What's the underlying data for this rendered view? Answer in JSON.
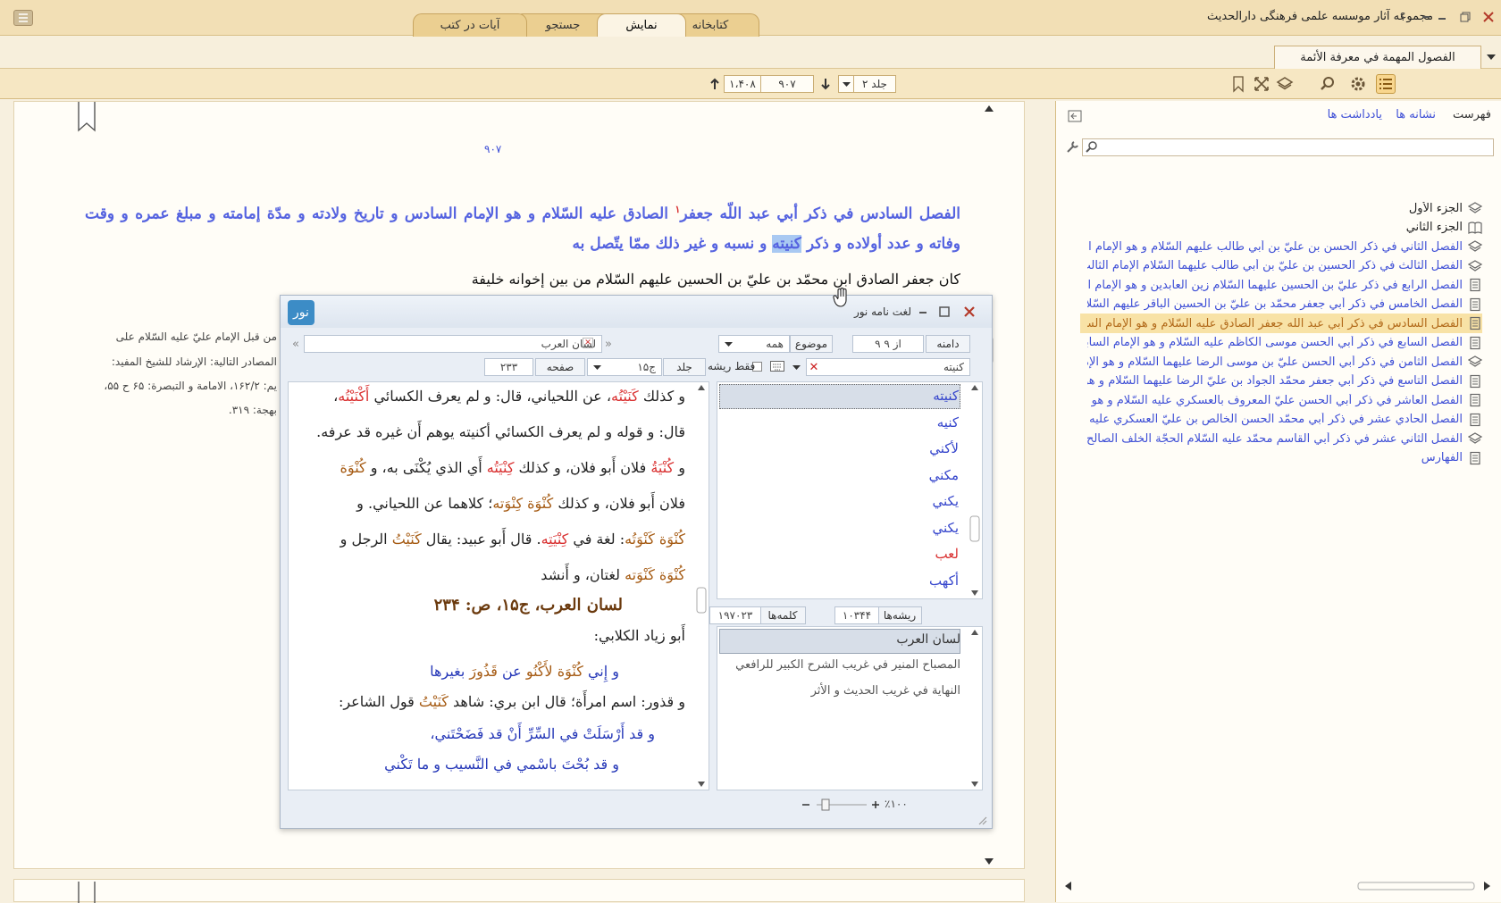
{
  "app": {
    "title": "مجموعه آثار موسسه علمی فرهنگی دارالحدیث",
    "help": "؟",
    "tabs": [
      "کتابخانه",
      "نمایش",
      "جستجو",
      "آیات در کتب"
    ],
    "active_tab": "نمایش"
  },
  "document_tab": "الفصول المهمة في معرفة الأئمة",
  "toolbar": {
    "volume": "جلد ۲",
    "page": "۹۰۷",
    "total_pages": "۱،۴۰۸"
  },
  "page": {
    "page_number": "۹۰۷",
    "chapter_title_part1": "الفصل السادس في ذكر أبي عبد اللّه جعفر",
    "footnote_marker": "١",
    "chapter_title_part2": "الصادق عليه السّلام و هو الإمام السادس و تاريخ ولادته و مدّة إمامته و مبلغ عمره و وقت وفاته و عدد أولاده و ذكر",
    "highlighted_word": "كنيته",
    "chapter_title_part3": "و نسبه و غير ذلك ممّا يتّصل به",
    "first_line": "كان جعفر الصادق ابن محمّد بن عليّ بن الحسين عليهم السّلام من بين إخوانه خليفة",
    "footnotes": [
      "من قبل الإمام عليّ عليه السّلام على",
      "المصادر التالية: الإرشاد للشيخ المفيد:",
      "يم: ۱۶۲/۲، الامامة و التبصرة: ۶۵ ح ۵۵،",
      "بهجة: ۳۱۹."
    ]
  },
  "sidebar": {
    "tabs": [
      "فهرست",
      "نشانه ها",
      "یادداشت ها"
    ],
    "search_placeholder": "",
    "tree": [
      {
        "label": "الجزء الأول",
        "type": "part"
      },
      {
        "label": "الجزء الثاني",
        "type": "part-open"
      },
      {
        "label": "الفصل الثاني في ذكر الحسن بن عليّ بن أبي طالب عليهم السّلام و هو الإمام الثاني",
        "type": "item"
      },
      {
        "label": "الفصل الثالث في ذكر الحسين بن عليّ بن أبي طالب عليهما السّلام الإمام الثالث",
        "type": "item"
      },
      {
        "label": "الفصل الرابع في ذكر عليّ بن الحسين عليهما السّلام زين العابدين و هو الإمام الرابع",
        "type": "item"
      },
      {
        "label": "الفصل الخامس في ذكر أبي جعفر محمّد بن عليّ بن الحسين الباقر عليهم السّلام",
        "type": "item"
      },
      {
        "label": "الفصل السادس في ذكر أبي عبد اللّه جعفر الصادق عليه السّلام و هو الإمام السادس",
        "type": "selected"
      },
      {
        "label": "الفصل السابع في ذكر أبي الحسن موسى الكاظم عليه السّلام و هو الإمام السابع",
        "type": "item"
      },
      {
        "label": "الفصل الثامن في ذكر أبي الحسن عليّ بن موسى الرضا عليهما السّلام و هو الإمام الثامن",
        "type": "item"
      },
      {
        "label": "الفصل التاسع في ذكر أبي جعفر محمّد الجواد بن عليّ الرضا عليهما السّلام و هو",
        "type": "item"
      },
      {
        "label": "الفصل العاشر في ذكر أبي الحسن عليّ المعروف بالعسكري عليه السّلام و هو الإمام",
        "type": "item"
      },
      {
        "label": "الفصل الحادي عشر في ذكر أبي محمّد الحسن الخالص بن عليّ العسكري عليه السّلام",
        "type": "item"
      },
      {
        "label": "الفصل الثاني عشر في ذكر أبي القاسم محمّد عليه السّلام الحجّة الخلف الصالح",
        "type": "item"
      },
      {
        "label": "الفهارس",
        "type": "item"
      }
    ]
  },
  "dictionary": {
    "title": "لغت نامه نور",
    "scope_label": "دامنه",
    "result_nav": "۹ از ۹",
    "topic_label": "موضوع",
    "topic_value": "همه",
    "source_value": "لسان العرب",
    "search_value": "کنیته",
    "root_only_label": "فقط ریشه",
    "volume_label": "جلد",
    "volume_value": "ج۱۵",
    "page_label": "صفحه",
    "page_value": "۲۳۳",
    "words": [
      "كنيته",
      "كنيه",
      "لأكني",
      "مكني",
      "يكني",
      "يكني",
      "لعب",
      "أكهب"
    ],
    "roots_label": "ریشه‌ها",
    "roots_count": "۱۰۳۴۴",
    "words_label": "کلمه‌ها",
    "words_count": "۱۹۷۰۲۳",
    "dictionaries": [
      "لسان العرب",
      "المصباح المنير في غريب الشرح الكبير للرافعي",
      "النهاية في غريب الحديث و الأثر"
    ],
    "zoom": "٪۱۰۰",
    "lexicon": {
      "l1a": "و كذلك",
      "l1b": "كَنَيْتُه",
      "l1c": "، عن اللحياني، قال: و لم يعرف الكسائي",
      "l1d": "أَكْنَيْتُه",
      "l2": "قال: و قوله و لم يعرف الكسائي أكنيته يوهم أَن غيره قد عرفه.",
      "l3a": "و",
      "l3b": "كُنْيَةُ",
      "l3c": "فلان أَبو فلان، و كذلك",
      "l3d": "كِنْيَتُه",
      "l3e": "أَي الذي يُكْنَى به، و",
      "l3f": "كُنْوَة",
      "l4a": "فلان أَبو فلان، و كذلك",
      "l4b": "كُنْوَة كِنْوَته",
      "l4c": "؛ كلاهما عن اللحياني. و",
      "l5a": "كُنْوَة كَنْوَتُه",
      "l5b": ": لغة في",
      "l5c": "كِنْيَتِه",
      "l5d": ". قال أَبو عبيد: يقال",
      "l5e": "كَنَيْتُ",
      "l5f": "الرجل و",
      "l6a": "كُنْوَة كَنْوَته",
      "l6b": "لغتان، و أَنشد",
      "ref": "لسان العرب، ج۱۵، ص: ۲۳۴",
      "l7": "أَبو زياد الكلابي:",
      "l8a": "و إِني",
      "l8b": "كُنْوَة",
      "l8c": "لأَكْنُو",
      "l8d": "عن",
      "l8e": "قَذُورَ",
      "l8f": "بغيرها",
      "l9a": "و قذور: اسم امرأَة؛ قال ابن بري: شاهد",
      "l9b": "كَنَيْتُ",
      "l9c": "قول الشاعر:",
      "l10": "و قد أَرْسَلَتْ في السِّرِّ أَنْ قد فَضَحْتَني،",
      "l11": "و قد بُحْتَ باسْمي في النَّسيب و ما تَكْني"
    }
  }
}
